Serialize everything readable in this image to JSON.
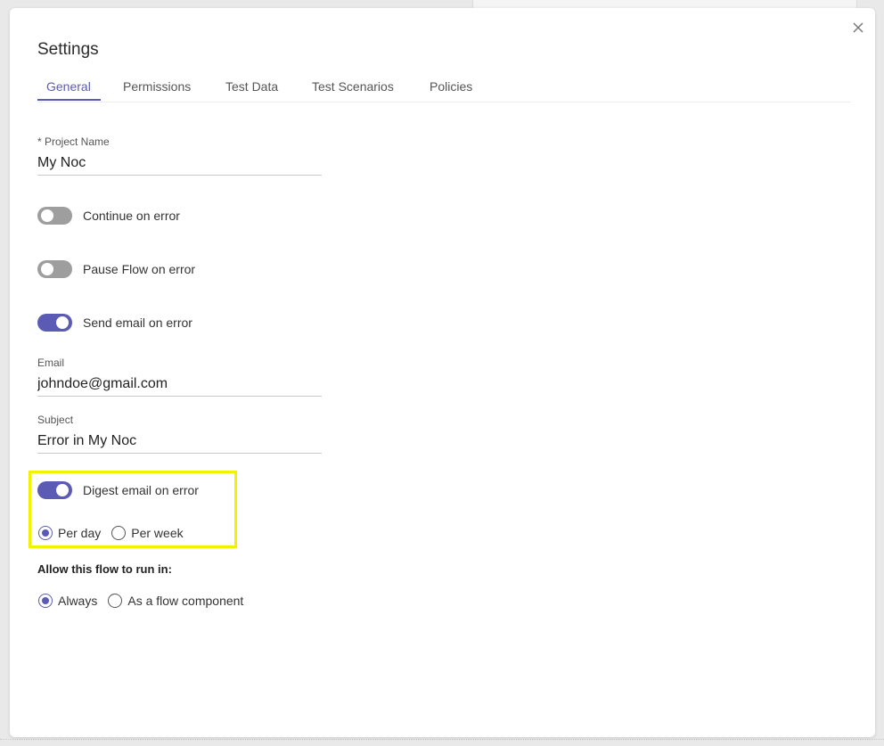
{
  "dialog": {
    "title": "Settings",
    "close_icon": "close-icon"
  },
  "tabs": [
    {
      "label": "General",
      "active": true
    },
    {
      "label": "Permissions",
      "active": false
    },
    {
      "label": "Test Data",
      "active": false
    },
    {
      "label": "Test Scenarios",
      "active": false
    },
    {
      "label": "Policies",
      "active": false
    }
  ],
  "project_name": {
    "label": "* Project Name",
    "value": "My Noc"
  },
  "toggles": {
    "continue_on_error": {
      "label": "Continue on error",
      "on": false
    },
    "pause_flow_on_error": {
      "label": "Pause Flow on error",
      "on": false
    },
    "send_email_on_error": {
      "label": "Send email on error",
      "on": true
    },
    "digest_email_on_error": {
      "label": "Digest email on error",
      "on": true
    }
  },
  "email": {
    "label": "Email",
    "value": "johndoe@gmail.com"
  },
  "subject": {
    "label": "Subject",
    "value": "Error in My Noc"
  },
  "digest_frequency": {
    "options": [
      {
        "label": "Per day",
        "checked": true
      },
      {
        "label": "Per week",
        "checked": false
      }
    ]
  },
  "run_in": {
    "label": "Allow this flow to run in:",
    "options": [
      {
        "label": "Always",
        "checked": true
      },
      {
        "label": "As a flow component",
        "checked": false
      }
    ]
  },
  "colors": {
    "accent": "#5b5bb5",
    "toggle_off": "#9e9e9e",
    "highlight": "#f2f200"
  }
}
